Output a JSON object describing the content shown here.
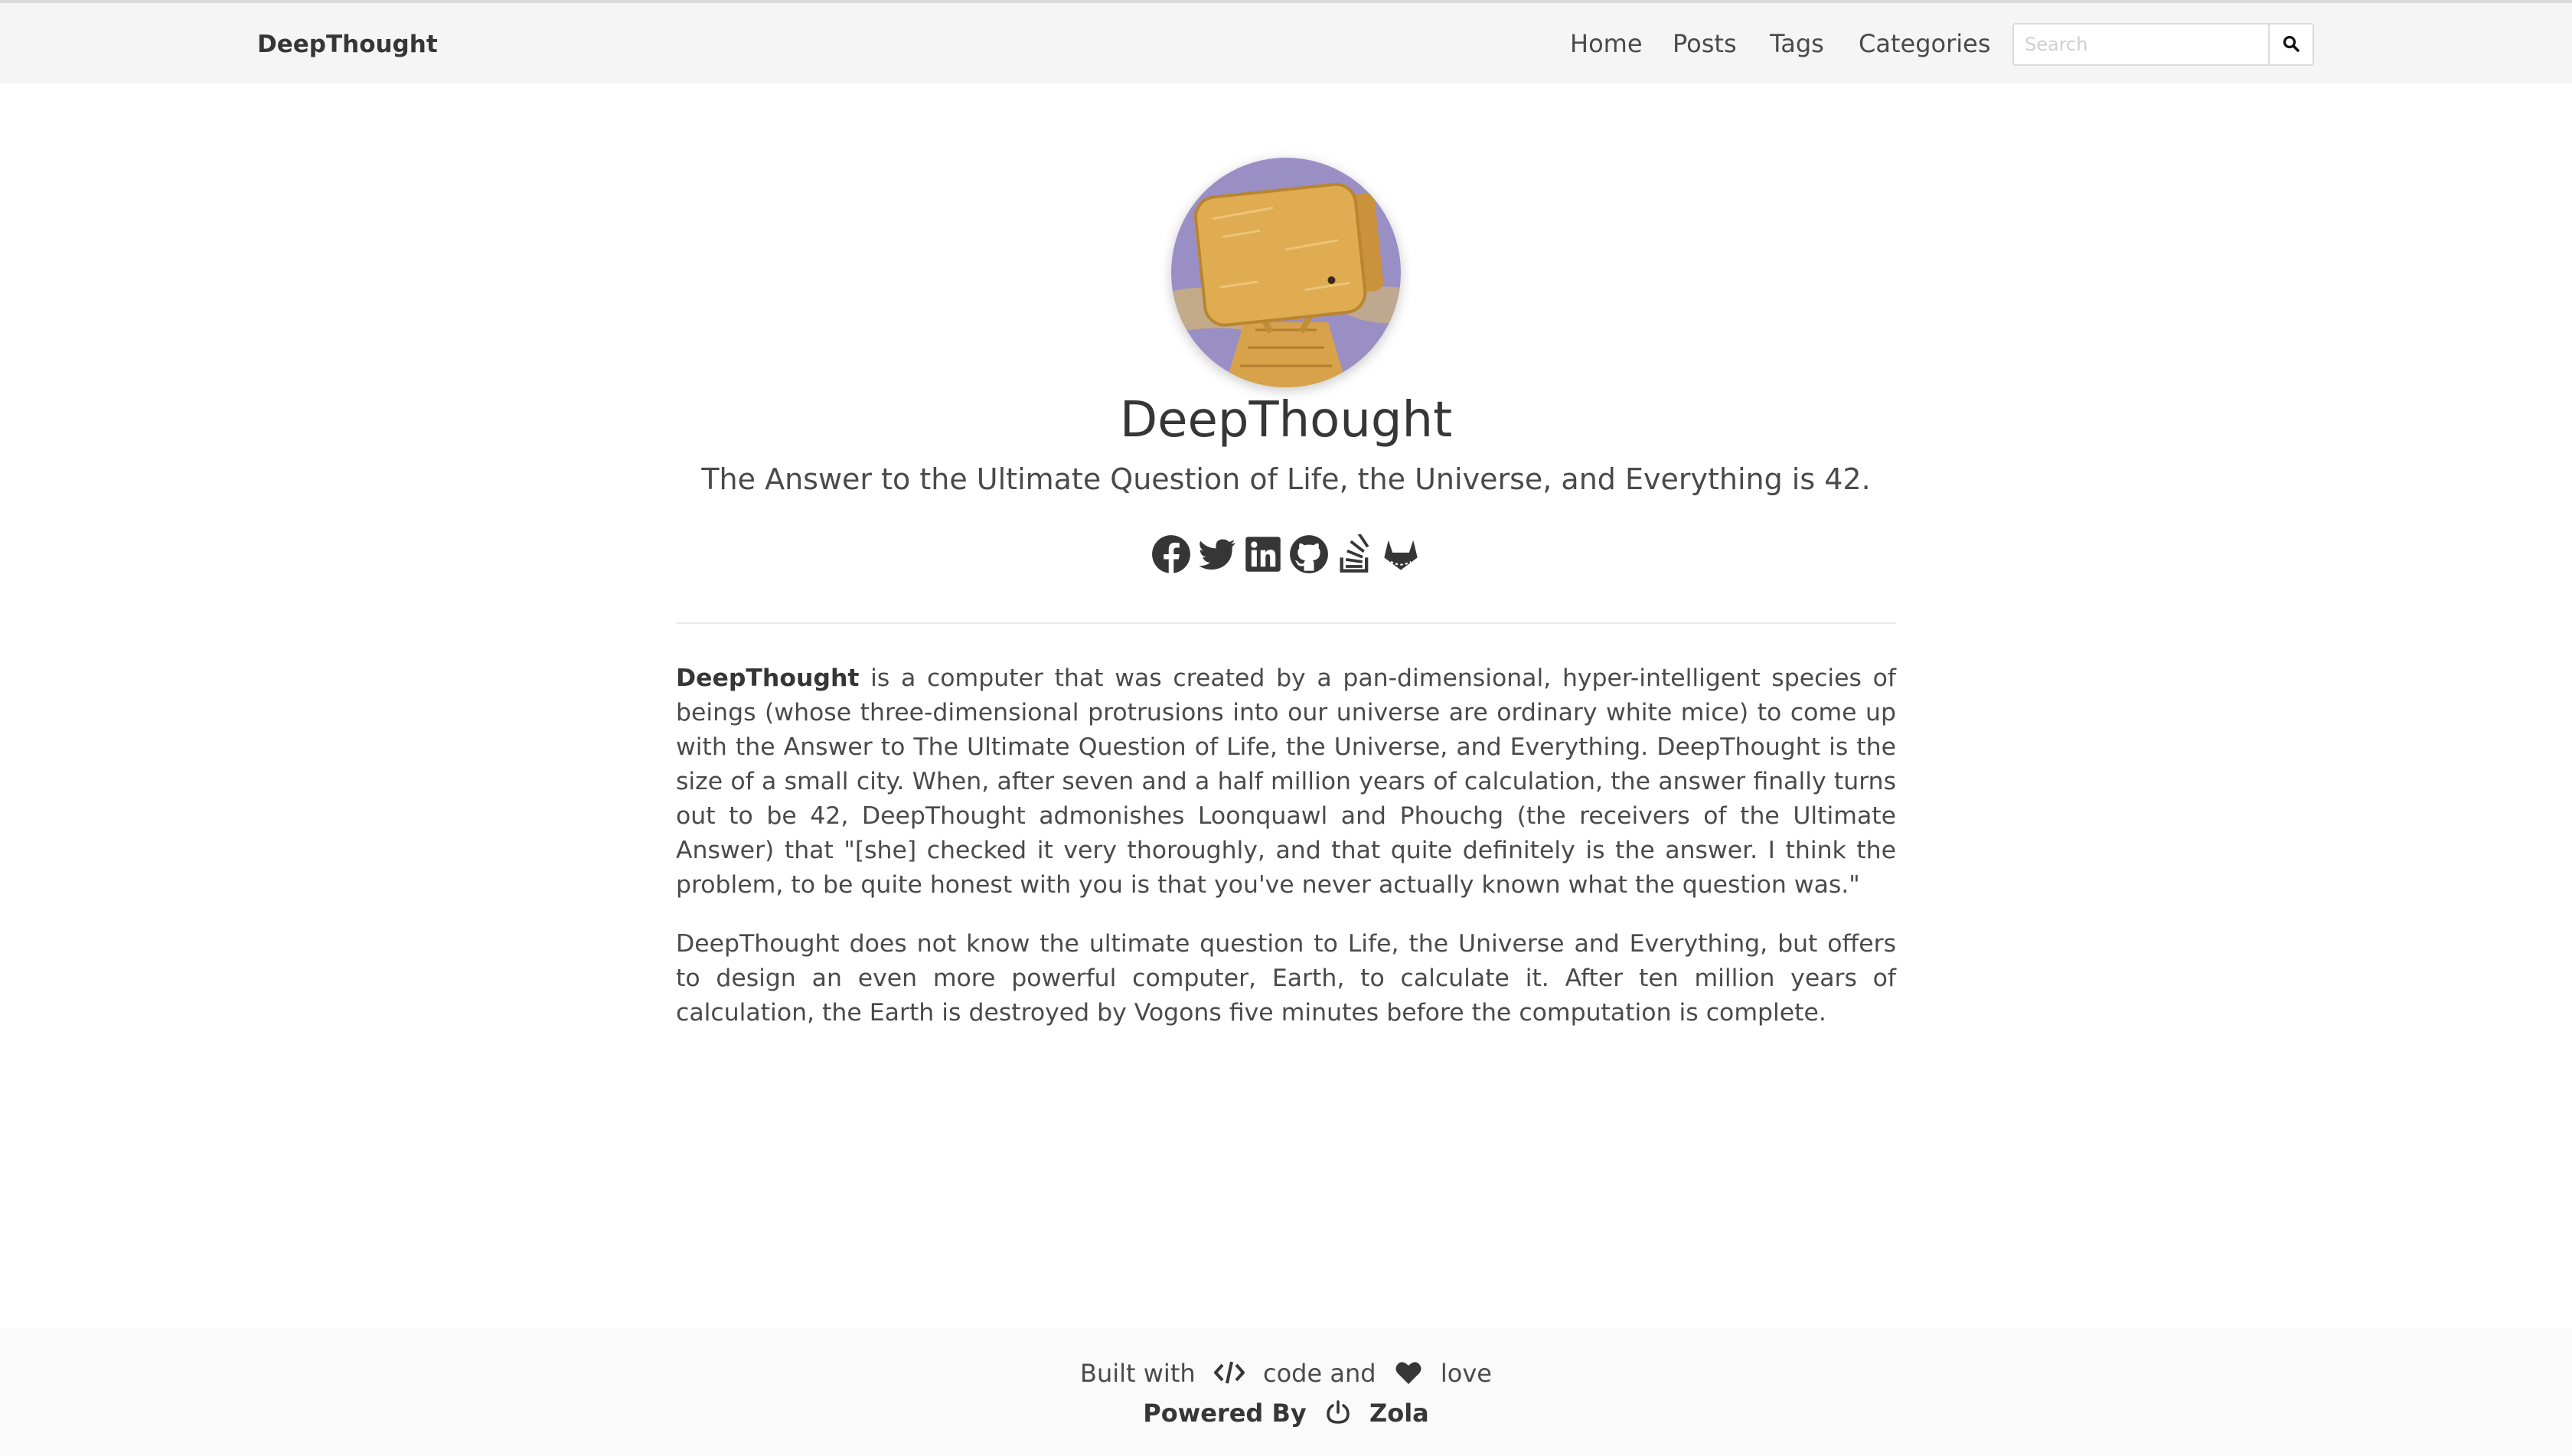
{
  "navbar": {
    "brand": "DeepThought",
    "links": [
      "Home",
      "Posts",
      "Tags",
      "Categories"
    ],
    "search_placeholder": "Search",
    "search_icon": "search-icon"
  },
  "profile": {
    "avatar_alt": "avatar",
    "title": "DeepThought",
    "subtitle": "The Answer to the Ultimate Question of Life, the Universe, and Everything is 42.",
    "social_icons": [
      "facebook-icon",
      "twitter-icon",
      "linkedin-icon",
      "github-icon",
      "stackoverflow-icon",
      "gitlab-icon"
    ]
  },
  "content": {
    "p1_bold": "DeepThought",
    "p1_text": " is a computer that was created by a pan-dimensional, hyper-intelligent species of beings (whose three-dimensional protrusions into our universe are ordinary white mice) to come up with the Answer to The Ultimate Question of Life, the Universe, and Everything. DeepThought is the size of a small city. When, after seven and a half million years of calculation, the answer finally turns out to be 42, DeepThought admonishes Loonquawl and Phouchg (the receivers of the Ultimate Answer) that \"[she] checked it very thoroughly, and that quite definitely is the answer. I think the problem, to be quite honest with you is that you've never actually known what the question was.\"",
    "p2": "DeepThought does not know the ultimate question to Life, the Universe and Everything, but offers to design an even more powerful computer, Earth, to calculate it. After ten million years of calculation, the Earth is destroyed by Vogons five minutes before the computation is complete."
  },
  "footer": {
    "built_with": "Built with",
    "code_and": "code and",
    "love": "love",
    "powered_by": "Powered By",
    "zola": "Zola"
  },
  "colors": {
    "navbar_bg": "#f5f5f5",
    "text": "#363636",
    "avatar_bg": "#9a8fc4",
    "avatar_gold": "#e0ac52"
  }
}
